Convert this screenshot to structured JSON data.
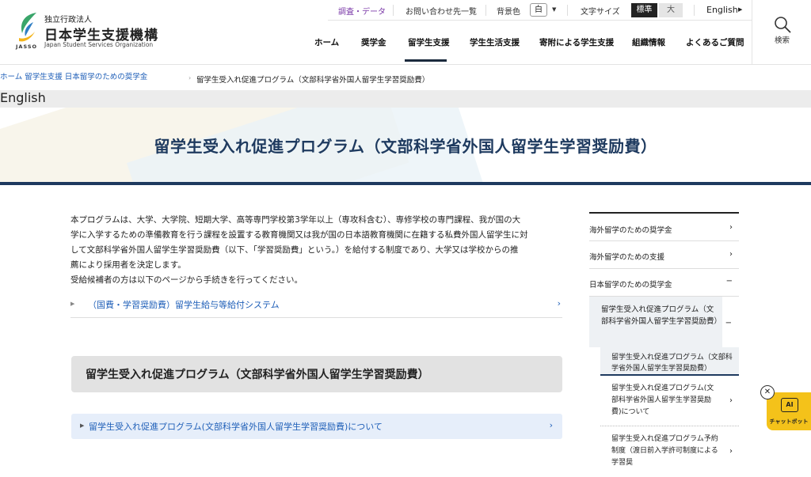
{
  "logo": {
    "small": "独立行政法人",
    "main": "日本学生支援機構",
    "abbr": "JASSO",
    "en": "Japan Student Services Organization"
  },
  "util": {
    "research": "調査・データ",
    "contact": "お問い合わせ先一覧",
    "bg_label": "背景色",
    "bg_value": "白",
    "size_label": "文字サイズ",
    "size_std": "標準",
    "size_big": "大",
    "english": "English"
  },
  "gnav": [
    "ホーム",
    "奨学金",
    "留学生支援",
    "学生生活支援",
    "寄附による学生支援",
    "組織情報",
    "よくあるご質問"
  ],
  "search_label": "検索",
  "breadcrumb": [
    "ホーム",
    "留学生支援",
    "日本留学のための奨学金",
    "留学生受入れ促進プログラム（文部科学省外国人留学生学習奨励費）"
  ],
  "lang_link": "English",
  "page_title": "留学生受入れ促進プログラム（文部科学省外国人留学生学習奨励費）",
  "intro": {
    "line1": "本プログラムは、大学、大学院、短期大学、高等専門学校第3学年以上（専攻科含む）、専修学校の専門課程、我が国の大",
    "line2": "学に入学するための準備教育を行う課程を設置する教育機関又は我が国の日本語教育機関に在籍する私費外国人留学生に対",
    "line3": "して文部科学省外国人留学生学習奨励費（以下、「学習奨励費」という。）を給付する制度であり、大学又は学校からの推",
    "line4": "薦により採用者を決定します。",
    "line5": "受給候補者の方は以下のページから手続きを行ってください。"
  },
  "link_row": "（国費・学習奨励費）留学生給与等給付システム",
  "section_heading": "留学生受入れ促進プログラム（文部科学省外国人留学生学習奨励費）",
  "blue_link": "留学生受入れ促進プログラム(文部科学省外国人留学生学習奨励費)について",
  "side": {
    "item1": "海外留学のための奨学金",
    "item2": "海外留学のための支援",
    "item3": "日本留学のための奨学金",
    "sub": "留学生受入れ促進プログラム（文部科学省外国人留学生学習奨励費）",
    "current": "留学生受入れ促進プログラム（文部科学省外国人留学生学習奨励費）",
    "leaf1": "留学生受入れ促進プログラム(文部科学省外国人留学生学習奨励費)について",
    "leaf2": "留学生受入れ促進プログラム予約制度（渡日前入学許可制度による学習奨"
  },
  "chat": {
    "icon": "AI",
    "label": "チャットボット"
  },
  "colors": {
    "primary": "#1e3a5f",
    "link": "#1f5fb8",
    "accent": "#f4c21a",
    "research": "#7b3aa8"
  }
}
